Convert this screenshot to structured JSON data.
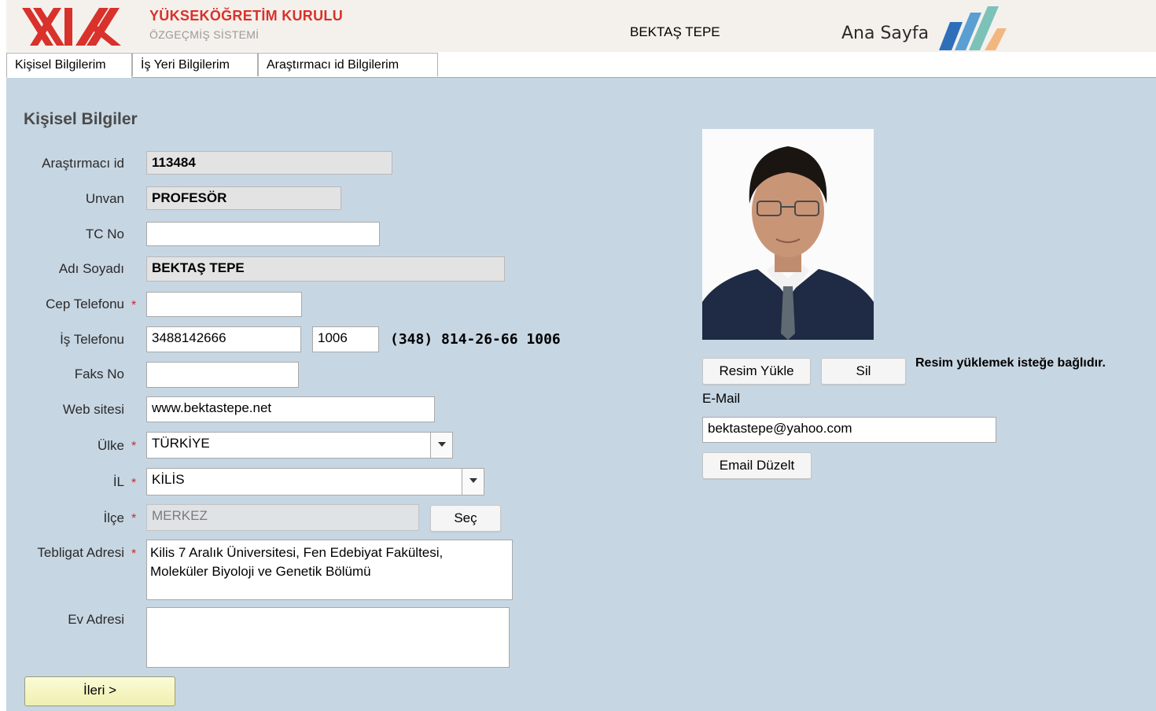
{
  "header": {
    "org_title": "YÜKSEKÖĞRETİM KURULU",
    "org_subtitle": "ÖZGEÇMİŞ SİSTEMİ",
    "user_name": "BEKTAŞ TEPE",
    "home_link": "Ana Sayfa",
    "brand_color": "#d9312b"
  },
  "tabs": [
    {
      "label": "Kişisel Bilgilerim",
      "active": true
    },
    {
      "label": "İş Yeri Bilgilerim",
      "active": false
    },
    {
      "label": "Araştırmacı id Bilgilerim",
      "active": false
    }
  ],
  "form": {
    "section_title": "Kişisel Bilgiler",
    "researcher_id": {
      "label": "Araştırmacı id",
      "value": "113484"
    },
    "title": {
      "label": "Unvan",
      "value": "PROFESÖR"
    },
    "tc_no": {
      "label": "TC No",
      "value": ""
    },
    "full_name": {
      "label": "Adı Soyadı",
      "value": "BEKTAŞ TEPE"
    },
    "mobile_phone": {
      "label": "Cep Telefonu",
      "value": "",
      "required_mark": "*"
    },
    "work_phone": {
      "label": "İş Telefonu",
      "value": "3488142666",
      "extension": "1006",
      "formatted": "(348) 814-26-66 1006"
    },
    "fax": {
      "label": "Faks No",
      "value": ""
    },
    "website": {
      "label": "Web sitesi",
      "value": "www.bektastepe.net"
    },
    "country": {
      "label": "Ülke",
      "value": "TÜRKİYE",
      "required_mark": "*"
    },
    "province": {
      "label": "İL",
      "value": "KİLİS",
      "required_mark": "*"
    },
    "district": {
      "label": "İlçe",
      "value": "MERKEZ",
      "required_mark": "*",
      "button": "Seç"
    },
    "notification_address": {
      "label": "Tebligat Adresi",
      "value": "Kilis 7 Aralık Üniversitesi, Fen Edebiyat Fakültesi,\nMoleküler Biyoloji ve Genetik Bölümü",
      "required_mark": "*"
    },
    "home_address": {
      "label": "Ev Adresi",
      "value": ""
    },
    "next_button": "İleri >"
  },
  "photo_panel": {
    "upload_button": "Resim Yükle",
    "delete_button": "Sil",
    "note": "Resim yüklemek isteğe bağlıdır.",
    "email_label": "E-Mail",
    "email_value": "bektastepe@yahoo.com",
    "email_edit_button": "Email Düzelt"
  },
  "colors": {
    "content_bg": "#c7d6e3",
    "header_bg": "#f4f1ec",
    "required": "#cc2a2a"
  }
}
